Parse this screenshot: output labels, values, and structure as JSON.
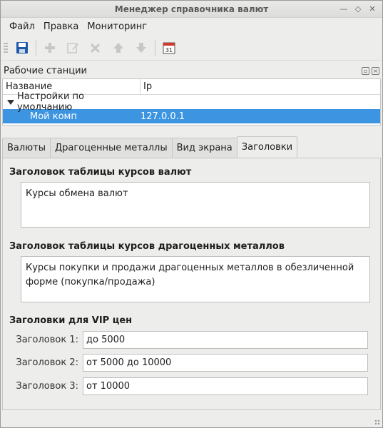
{
  "window": {
    "title": "Менеджер справочника валют"
  },
  "menu": [
    "Файл",
    "Правка",
    "Мониторинг"
  ],
  "toolbar": {
    "buttons": [
      {
        "name": "save-icon",
        "enabled": true
      },
      {
        "name": "add-icon",
        "enabled": false
      },
      {
        "name": "edit-icon",
        "enabled": false
      },
      {
        "name": "delete-icon",
        "enabled": false
      },
      {
        "name": "move-up-icon",
        "enabled": false
      },
      {
        "name": "move-down-icon",
        "enabled": false
      },
      {
        "name": "calendar-icon",
        "enabled": true,
        "label": "31"
      }
    ]
  },
  "workstations": {
    "title": "Рабочие станции",
    "columns": [
      "Название",
      "Ip"
    ],
    "group": "Настройки по умолчанию",
    "rows": [
      {
        "name": "Мой комп",
        "ip": "127.0.0.1"
      }
    ]
  },
  "tabs": [
    "Валюты",
    "Драгоценные металлы",
    "Вид экрана",
    "Заголовки"
  ],
  "active_tab": "Заголовки",
  "headers": {
    "currency_title": "Заголовок таблицы курсов валют",
    "currency_value": "Курсы обмена валют",
    "metals_title": "Заголовок таблицы курсов драгоценных металлов",
    "metals_value": "Курсы покупки и продажи драгоценных металлов в обезличенной форме (покупка/продажа)",
    "vip_title": "Заголовки для VIP цен",
    "vip": [
      {
        "label": "Заголовок 1:",
        "value": "до 5000"
      },
      {
        "label": "Заголовок 2:",
        "value": "от 5000 до 10000"
      },
      {
        "label": "Заголовок 3:",
        "value": "от 10000"
      }
    ]
  },
  "colors": {
    "selection": "#3d95e2",
    "save_icon": "#1f5aa8",
    "calendar_red": "#d23a2c"
  }
}
